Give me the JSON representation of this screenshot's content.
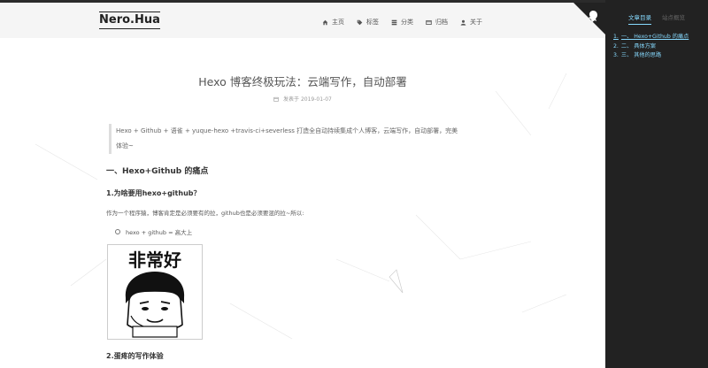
{
  "site": {
    "brand": "Nero.Hua"
  },
  "nav": [
    {
      "icon": "home-icon",
      "label": "主页"
    },
    {
      "icon": "tag-icon",
      "label": "标签"
    },
    {
      "icon": "grid-icon",
      "label": "分类"
    },
    {
      "icon": "archive-icon",
      "label": "归档"
    },
    {
      "icon": "user-icon",
      "label": "关于"
    }
  ],
  "sidebar": {
    "tabs": [
      "文章目录",
      "站点概览"
    ],
    "toc": [
      {
        "num": "1.",
        "label": "一、 Hexo+Github 的痛点"
      },
      {
        "num": "2.",
        "label": "二、 具体方案"
      },
      {
        "num": "3.",
        "label": "三、 其他的思路"
      }
    ]
  },
  "post": {
    "title": "Hexo 博客终极玩法：云端写作，自动部署",
    "meta_label": "发表于",
    "date": "2019-01-07",
    "quote_line1": "Hexo + Github + 语雀 + yuque-hexo +travis-ci+severless 打造全自动持续集成个人博客，云端写作，自动部署，完美",
    "quote_line2": "体验~",
    "h1": "一、Hexo+Github 的痛点",
    "h2_1": "1.为啥要用hexo+github？",
    "para_1": "作为一个程序猿，博客肯定是必须要有的拉，github也是必须要混的拉~所以:",
    "bullet_1": "hexo + github = 高大上",
    "meme_text": "非常好",
    "h2_2": "2.蛋疼的写作体验"
  },
  "colors": {
    "accent": "#87daff",
    "sidebar_bg": "#222222",
    "header_bg": "#f5f5f5"
  }
}
